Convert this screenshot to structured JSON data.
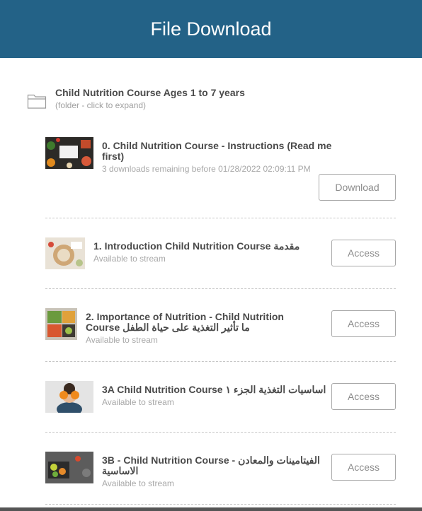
{
  "header": {
    "title": "File Download"
  },
  "folder": {
    "title": "Child Nutrition Course Ages 1 to 7 years",
    "subtitle": "(folder - click to expand)"
  },
  "items": [
    {
      "title": "0. Child Nutrition Course - Instructions (Read me first)",
      "status": "3 downloads remaining before 01/28/2022 02:09:11 PM",
      "action": "Download"
    },
    {
      "title": "1. Introduction Child Nutrition Course مقدمة",
      "status": "Available to stream",
      "action": "Access"
    },
    {
      "title": "2. Importance of Nutrition - Child Nutrition Course ما تأثير التغذية على حياة الطفل",
      "status": "Available to stream",
      "action": "Access"
    },
    {
      "title": "3A Child Nutrition Course اساسيات التغذية الجزء ١",
      "status": "Available to stream",
      "action": "Access"
    },
    {
      "title": "3B - Child Nutrition Course - الفيتامينات والمعادن الاساسية",
      "status": "Available to stream",
      "action": "Access"
    }
  ]
}
